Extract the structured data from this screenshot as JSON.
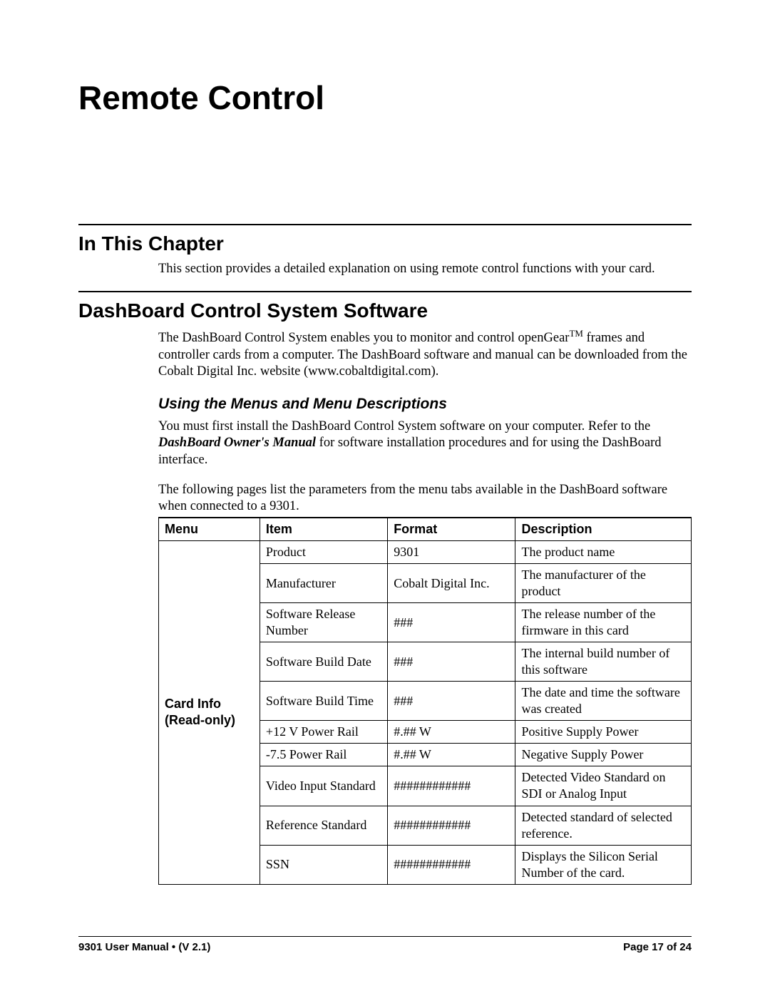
{
  "chapter_title": "Remote Control",
  "sections": {
    "in_this_chapter": {
      "heading": "In This Chapter",
      "body": "This section provides a detailed explanation on using remote control functions with your card."
    },
    "dashboard": {
      "heading": "DashBoard Control System Software",
      "intro_pre": "The DashBoard Control System enables you to monitor and control openGear",
      "intro_tm": "TM",
      "intro_post": " frames and controller cards from a computer. The DashBoard software and manual can be downloaded from the Cobalt Digital Inc. website (www.cobaltdigital.com).",
      "subheading": "Using the Menus and Menu Descriptions",
      "p1_pre": "You must first install the DashBoard Control System software on your computer. Refer to the ",
      "p1_em": "DashBoard Owner's Manual",
      "p1_post": " for software installation procedures and for using the DashBoard interface.",
      "p2": "The following pages list the parameters from the menu tabs available in the DashBoard software when connected to a 9301."
    }
  },
  "table": {
    "headers": {
      "menu": "Menu",
      "item": "Item",
      "format": "Format",
      "description": "Description"
    },
    "menu_label_line1": "Card Info",
    "menu_label_line2": "(Read-only)",
    "rows": [
      {
        "item": "Product",
        "format": "9301",
        "desc": "The product name"
      },
      {
        "item": "Manufacturer",
        "format": "Cobalt Digital Inc.",
        "desc": "The manufacturer of the product"
      },
      {
        "item": "Software Release Number",
        "format": "###",
        "desc": "The release number of the firmware in this card"
      },
      {
        "item": "Software Build Date",
        "format": "###",
        "desc": "The internal build number of this software"
      },
      {
        "item": "Software Build Time",
        "format": "###",
        "desc": "The date and time the software was created"
      },
      {
        "item": "+12 V Power Rail",
        "format": "#.## W",
        "desc": "Positive Supply Power"
      },
      {
        "item": "-7.5 Power Rail",
        "format": "#.## W",
        "desc": "Negative Supply Power"
      },
      {
        "item": "Video Input Standard",
        "format": "############",
        "desc": "Detected Video Standard on SDI or Analog Input"
      },
      {
        "item": "Reference Standard",
        "format": "############",
        "desc": "Detected standard of selected reference."
      },
      {
        "item": "SSN",
        "format": "############",
        "desc": "Displays the Silicon Serial Number of the card."
      }
    ]
  },
  "footer": {
    "left": "9301 User Manual  •  (V 2.1)",
    "right": "Page 17 of 24"
  }
}
